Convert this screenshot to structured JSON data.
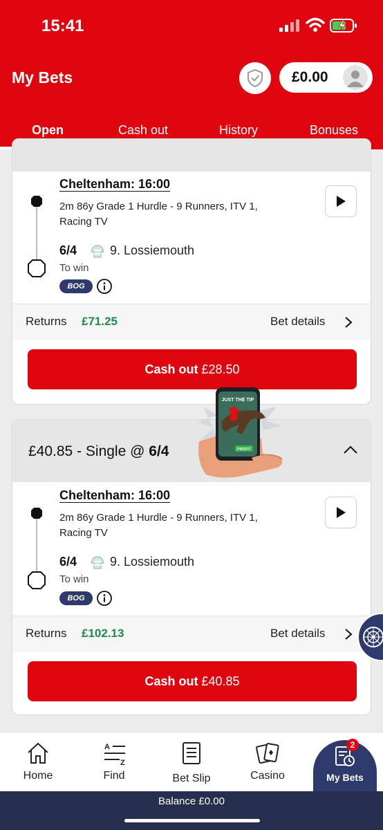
{
  "status_bar": {
    "time": "15:41"
  },
  "header": {
    "title": "My Bets",
    "balance": "£0.00",
    "tabs": [
      {
        "label": "Open",
        "active": true
      },
      {
        "label": "Cash out",
        "active": false
      },
      {
        "label": "History",
        "active": false
      },
      {
        "label": "Bonuses",
        "active": false
      }
    ]
  },
  "bets": [
    {
      "header": "",
      "event": "Cheltenham: 16:00",
      "description": "2m 86y Grade 1 Hurdle - 9 Runners, ITV 1, Racing TV",
      "odds": "6/4",
      "selection": "9. Lossiemouth",
      "bet_type": "To win",
      "badge": "BOG",
      "returns_label": "Returns",
      "returns_value": "£71.25",
      "details_label": "Bet details",
      "cashout_label": "Cash out",
      "cashout_value": "£28.50"
    },
    {
      "header_stake": "£40.85 - Single @",
      "header_odds": "6/4",
      "event": "Cheltenham: 16:00",
      "description": "2m 86y Grade 1 Hurdle - 9 Runners, ITV 1, Racing TV",
      "odds": "6/4",
      "selection": "9. Lossiemouth",
      "bet_type": "To win",
      "badge": "BOG",
      "returns_label": "Returns",
      "returns_value": "£102.13",
      "details_label": "Bet details",
      "cashout_label": "Cash out",
      "cashout_value": "£40.85"
    }
  ],
  "promo": {
    "screen_text": "JUST THE TIP",
    "button_text": "PROFIT"
  },
  "bottom_nav": {
    "items": [
      {
        "label": "Home",
        "icon": "home-icon"
      },
      {
        "label": "Find",
        "icon": "a-z-icon"
      },
      {
        "label": "Bet Slip",
        "icon": "bet-slip-icon"
      },
      {
        "label": "Casino",
        "icon": "cards-icon"
      },
      {
        "label": "My Bets",
        "icon": "my-bets-icon",
        "active": true,
        "badge": "2"
      }
    ]
  },
  "footer": {
    "balance_text": "Balance £0.00"
  },
  "colors": {
    "brand_red": "#e0060f",
    "navy": "#2d3a6b",
    "returns_green": "#1f8a4c"
  }
}
